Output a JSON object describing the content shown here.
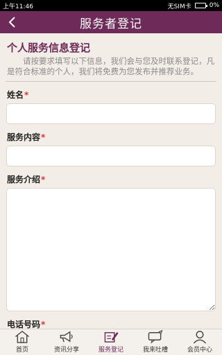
{
  "status_bar": {
    "time": "上午11:46",
    "carrier": "无SIM卡",
    "battery": "0%"
  },
  "nav": {
    "title": "服务者登记",
    "back_icon": "chevron-left-icon"
  },
  "form": {
    "section_title": "个人服务信息登记",
    "intro": "请按要求填写以下信息，我们会与您及时联系登记，凡是符合标准的个人，我们将免费为您发布并推荐业务。",
    "required_mark": "*",
    "fields": [
      {
        "label": "姓名",
        "value": ""
      },
      {
        "label": "服务内容",
        "value": ""
      },
      {
        "label": "服务介绍",
        "value": ""
      },
      {
        "label": "电话号码",
        "value": ""
      }
    ]
  },
  "tabbar": {
    "items": [
      {
        "label": "首页",
        "icon": "home-icon",
        "active": false
      },
      {
        "label": "资讯分享",
        "icon": "megaphone-icon",
        "active": false
      },
      {
        "label": "服务登记",
        "icon": "edit-icon",
        "active": true
      },
      {
        "label": "我来吐槽",
        "icon": "chat-icon",
        "active": false
      },
      {
        "label": "会员中心",
        "icon": "user-icon",
        "active": false
      }
    ]
  },
  "colors": {
    "accent": "#6e2b59",
    "background": "#f2ede6",
    "required": "#dd3333"
  }
}
